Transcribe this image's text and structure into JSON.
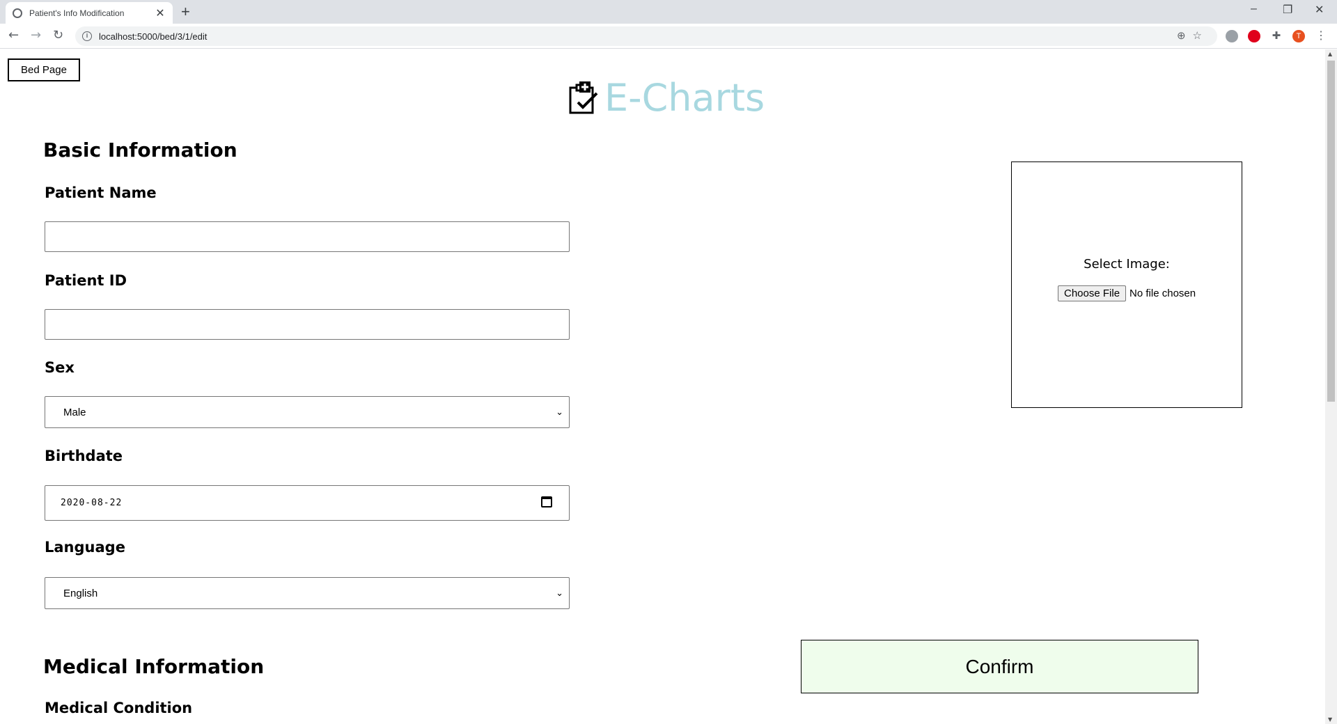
{
  "browser": {
    "tab_title": "Patient's Info Modification",
    "tab_close": "✕",
    "new_tab": "+",
    "url": "localhost:5000/bed/3/1/edit",
    "profile_initial": "T",
    "min": "–",
    "restore": "❐",
    "close": "✕"
  },
  "nav": {
    "bed_page_label": "Bed Page"
  },
  "logo": {
    "brand": "E-Charts"
  },
  "basic": {
    "heading": "Basic Information",
    "patient_name_label": "Patient Name",
    "patient_name_value": "",
    "patient_id_label": "Patient ID",
    "patient_id_value": "",
    "sex_label": "Sex",
    "sex_value": "Male",
    "birthdate_label": "Birthdate",
    "birthdate_value": "2020-08-22",
    "language_label": "Language",
    "language_value": "English"
  },
  "image": {
    "label": "Select Image:",
    "choose_button": "Choose File",
    "file_status": "No file chosen"
  },
  "medical": {
    "heading": "Medical Information",
    "condition_label": "Medical Condition"
  },
  "actions": {
    "confirm_label": "Confirm"
  },
  "colors": {
    "brand": "#a8d8e0",
    "confirm_bg": "#effdec"
  }
}
